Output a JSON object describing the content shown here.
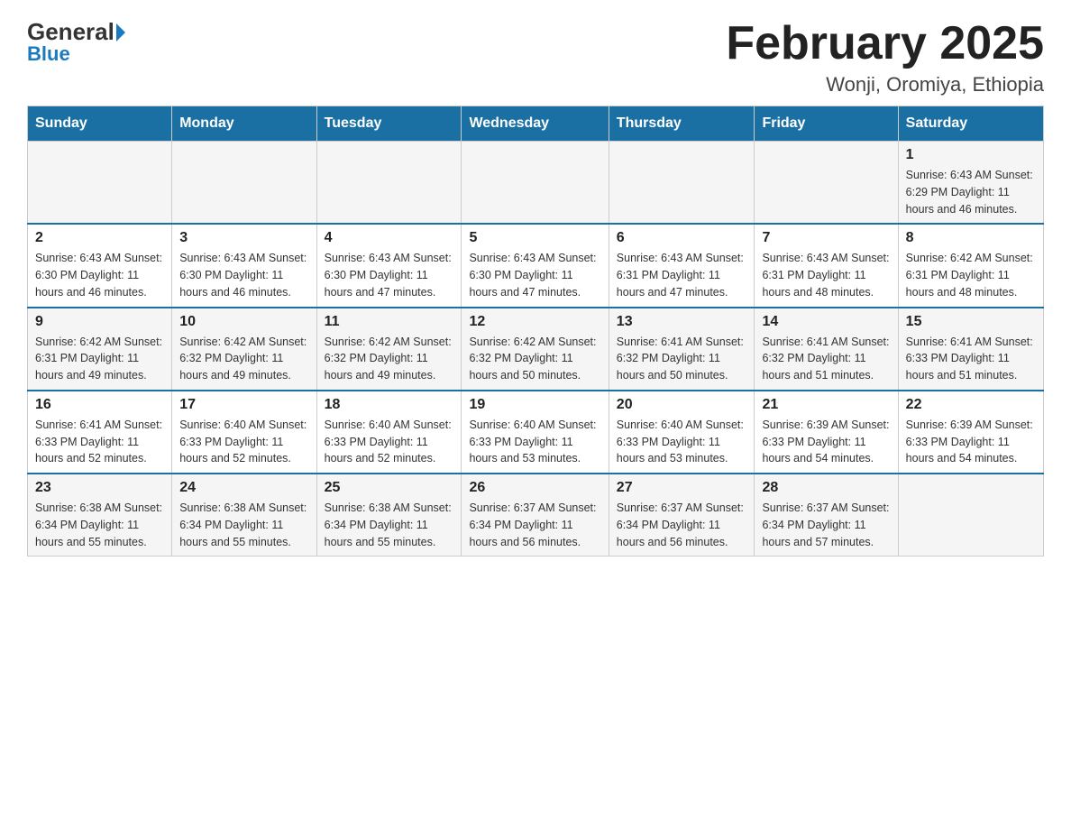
{
  "header": {
    "logo_general": "General",
    "logo_blue": "Blue",
    "month_title": "February 2025",
    "location": "Wonji, Oromiya, Ethiopia"
  },
  "days_of_week": [
    "Sunday",
    "Monday",
    "Tuesday",
    "Wednesday",
    "Thursday",
    "Friday",
    "Saturday"
  ],
  "weeks": [
    [
      {
        "day": "",
        "info": ""
      },
      {
        "day": "",
        "info": ""
      },
      {
        "day": "",
        "info": ""
      },
      {
        "day": "",
        "info": ""
      },
      {
        "day": "",
        "info": ""
      },
      {
        "day": "",
        "info": ""
      },
      {
        "day": "1",
        "info": "Sunrise: 6:43 AM\nSunset: 6:29 PM\nDaylight: 11 hours and 46 minutes."
      }
    ],
    [
      {
        "day": "2",
        "info": "Sunrise: 6:43 AM\nSunset: 6:30 PM\nDaylight: 11 hours and 46 minutes."
      },
      {
        "day": "3",
        "info": "Sunrise: 6:43 AM\nSunset: 6:30 PM\nDaylight: 11 hours and 46 minutes."
      },
      {
        "day": "4",
        "info": "Sunrise: 6:43 AM\nSunset: 6:30 PM\nDaylight: 11 hours and 47 minutes."
      },
      {
        "day": "5",
        "info": "Sunrise: 6:43 AM\nSunset: 6:30 PM\nDaylight: 11 hours and 47 minutes."
      },
      {
        "day": "6",
        "info": "Sunrise: 6:43 AM\nSunset: 6:31 PM\nDaylight: 11 hours and 47 minutes."
      },
      {
        "day": "7",
        "info": "Sunrise: 6:43 AM\nSunset: 6:31 PM\nDaylight: 11 hours and 48 minutes."
      },
      {
        "day": "8",
        "info": "Sunrise: 6:42 AM\nSunset: 6:31 PM\nDaylight: 11 hours and 48 minutes."
      }
    ],
    [
      {
        "day": "9",
        "info": "Sunrise: 6:42 AM\nSunset: 6:31 PM\nDaylight: 11 hours and 49 minutes."
      },
      {
        "day": "10",
        "info": "Sunrise: 6:42 AM\nSunset: 6:32 PM\nDaylight: 11 hours and 49 minutes."
      },
      {
        "day": "11",
        "info": "Sunrise: 6:42 AM\nSunset: 6:32 PM\nDaylight: 11 hours and 49 minutes."
      },
      {
        "day": "12",
        "info": "Sunrise: 6:42 AM\nSunset: 6:32 PM\nDaylight: 11 hours and 50 minutes."
      },
      {
        "day": "13",
        "info": "Sunrise: 6:41 AM\nSunset: 6:32 PM\nDaylight: 11 hours and 50 minutes."
      },
      {
        "day": "14",
        "info": "Sunrise: 6:41 AM\nSunset: 6:32 PM\nDaylight: 11 hours and 51 minutes."
      },
      {
        "day": "15",
        "info": "Sunrise: 6:41 AM\nSunset: 6:33 PM\nDaylight: 11 hours and 51 minutes."
      }
    ],
    [
      {
        "day": "16",
        "info": "Sunrise: 6:41 AM\nSunset: 6:33 PM\nDaylight: 11 hours and 52 minutes."
      },
      {
        "day": "17",
        "info": "Sunrise: 6:40 AM\nSunset: 6:33 PM\nDaylight: 11 hours and 52 minutes."
      },
      {
        "day": "18",
        "info": "Sunrise: 6:40 AM\nSunset: 6:33 PM\nDaylight: 11 hours and 52 minutes."
      },
      {
        "day": "19",
        "info": "Sunrise: 6:40 AM\nSunset: 6:33 PM\nDaylight: 11 hours and 53 minutes."
      },
      {
        "day": "20",
        "info": "Sunrise: 6:40 AM\nSunset: 6:33 PM\nDaylight: 11 hours and 53 minutes."
      },
      {
        "day": "21",
        "info": "Sunrise: 6:39 AM\nSunset: 6:33 PM\nDaylight: 11 hours and 54 minutes."
      },
      {
        "day": "22",
        "info": "Sunrise: 6:39 AM\nSunset: 6:33 PM\nDaylight: 11 hours and 54 minutes."
      }
    ],
    [
      {
        "day": "23",
        "info": "Sunrise: 6:38 AM\nSunset: 6:34 PM\nDaylight: 11 hours and 55 minutes."
      },
      {
        "day": "24",
        "info": "Sunrise: 6:38 AM\nSunset: 6:34 PM\nDaylight: 11 hours and 55 minutes."
      },
      {
        "day": "25",
        "info": "Sunrise: 6:38 AM\nSunset: 6:34 PM\nDaylight: 11 hours and 55 minutes."
      },
      {
        "day": "26",
        "info": "Sunrise: 6:37 AM\nSunset: 6:34 PM\nDaylight: 11 hours and 56 minutes."
      },
      {
        "day": "27",
        "info": "Sunrise: 6:37 AM\nSunset: 6:34 PM\nDaylight: 11 hours and 56 minutes."
      },
      {
        "day": "28",
        "info": "Sunrise: 6:37 AM\nSunset: 6:34 PM\nDaylight: 11 hours and 57 minutes."
      },
      {
        "day": "",
        "info": ""
      }
    ]
  ]
}
